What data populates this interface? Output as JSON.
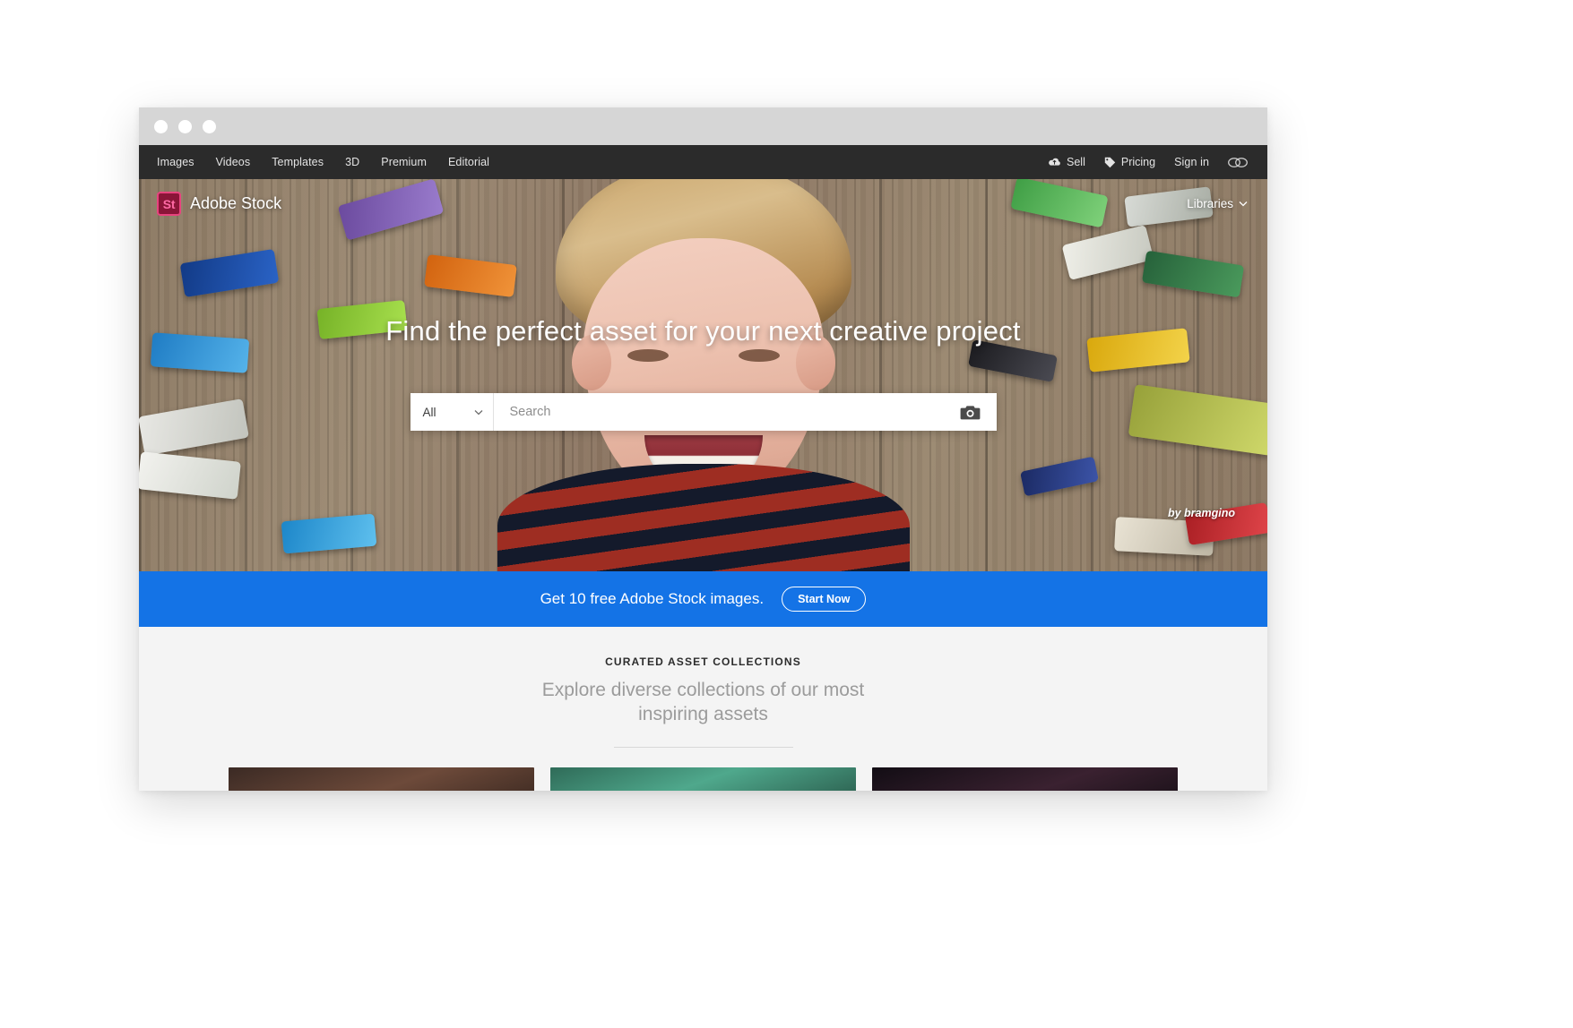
{
  "window": {
    "traffic_lights": [
      "close",
      "minimize",
      "zoom"
    ]
  },
  "topnav": {
    "left_items": [
      {
        "label": "Images"
      },
      {
        "label": "Videos"
      },
      {
        "label": "Templates"
      },
      {
        "label": "3D"
      },
      {
        "label": "Premium"
      },
      {
        "label": "Editorial"
      }
    ],
    "right_items": [
      {
        "label": "Sell",
        "icon": "cloud-upload-icon"
      },
      {
        "label": "Pricing",
        "icon": "price-tag-icon"
      },
      {
        "label": "Sign in",
        "icon": ""
      }
    ],
    "app_switcher_icon": "creative-cloud-icon"
  },
  "brand": {
    "badge_text": "St",
    "name": "Adobe Stock",
    "badge_bg": "#8a1538",
    "badge_border": "#e8437e",
    "badge_color": "#ff6aa5"
  },
  "libraries": {
    "label": "Libraries",
    "chevron_icon": "chevron-down-icon"
  },
  "hero": {
    "headline": "Find the perfect asset for your next creative project",
    "watermark": "by bramgino",
    "search": {
      "filter_value": "All",
      "filter_chevron_icon": "chevron-down-icon",
      "placeholder": "Search",
      "camera_icon": "camera-search-icon"
    }
  },
  "promo": {
    "text": "Get 10 free Adobe Stock images.",
    "button_label": "Start Now",
    "bg": "#1473e6"
  },
  "curated": {
    "kicker": "CURATED ASSET COLLECTIONS",
    "subhead": "Explore diverse collections of our most inspiring assets",
    "cards": [
      {
        "name": "collection-card-1"
      },
      {
        "name": "collection-card-2"
      },
      {
        "name": "collection-card-3"
      }
    ]
  }
}
